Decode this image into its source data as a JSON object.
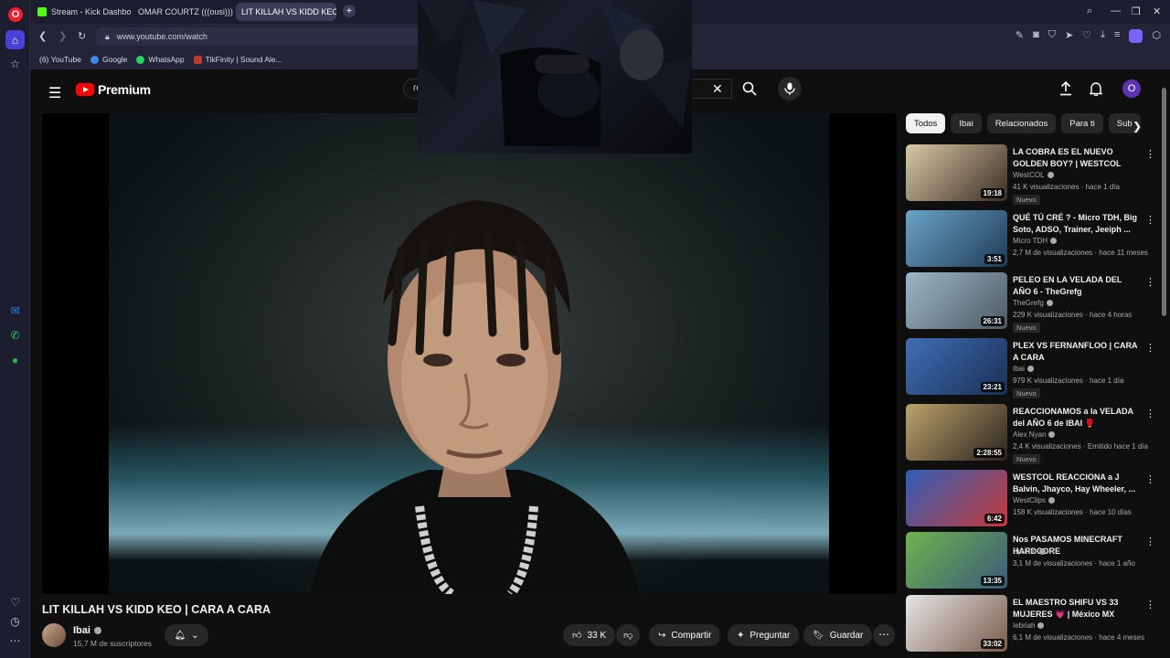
{
  "browser": {
    "tabs": [
      {
        "label": "Stream - Kick Dashboard",
        "favicon": "kick-icon"
      },
      {
        "label": "OMAR COURTZ (((ousi)))",
        "favicon": "youtube-icon"
      },
      {
        "label": "LIT KILLAH VS KIDD KEO |",
        "favicon": "youtube-icon",
        "active": true
      }
    ],
    "url": "www.youtube.com/watch",
    "bookmarks": [
      {
        "label": "(6) YouTube"
      },
      {
        "label": "Google"
      },
      {
        "label": "WhatsApp"
      },
      {
        "label": "TikFinity | Sound Ale..."
      }
    ]
  },
  "youtube": {
    "logo_text": "Premium",
    "search_value": "re",
    "avatar_letter": "O"
  },
  "video": {
    "title": "LIT KILLAH VS KIDD KEO | CARA A CARA",
    "channel": "Ibai",
    "subscribers": "15,7 M de suscriptores",
    "likes": "33 K",
    "share_label": "Compartir",
    "ask_label": "Preguntar",
    "save_label": "Guardar"
  },
  "chips": [
    "Todos",
    "Ibai",
    "Relacionados",
    "Para ti",
    "Sub"
  ],
  "related": [
    {
      "title": "LA COBRA ES EL NUEVO GOLDEN BOY? | WESTCOL",
      "channel": "WestCOL",
      "meta": "41 K visualizaciones · hace 1 día",
      "duration": "19:18",
      "badge": "Nuevo",
      "thumb_colors": [
        "#d8c9a6",
        "#3a2d24"
      ]
    },
    {
      "title": "QUÉ TÚ CRÉ ? - Micro TDH, Big Soto, ADSO, Trainer, Jeeiph ...",
      "channel": "Micro TDH",
      "meta": "2,7 M de visualizaciones · hace 11 meses",
      "duration": "3:51",
      "badge": "",
      "thumb_colors": [
        "#6aa3c8",
        "#1e3b55"
      ]
    },
    {
      "title": "PELEO EN LA VELADA DEL AÑO 6 - TheGrefg",
      "channel": "TheGrefg",
      "meta": "229 K visualizaciones · hace 4 horas",
      "duration": "26:31",
      "badge": "Nuevo",
      "thumb_colors": [
        "#9db6c5",
        "#4d5a63"
      ]
    },
    {
      "title": "PLEX VS FERNANFLOO | CARA A CARA",
      "channel": "Ibai",
      "meta": "979 K visualizaciones · hace 1 día",
      "duration": "23:21",
      "badge": "Nuevo",
      "thumb_colors": [
        "#3f6fb5",
        "#1a2f55"
      ]
    },
    {
      "title": "REACCIONAMOS a la VELADA del AÑO 6 de IBAI 🥊",
      "channel": "Alex Nyan",
      "meta": "2,4 K visualizaciones · Emitido hace 1 día",
      "duration": "2:28:55",
      "badge": "Nuevo",
      "thumb_colors": [
        "#bca36a",
        "#2a2420"
      ]
    },
    {
      "title": "WESTCOL REACCIONA a J Balvin, Jhayco, Hay Wheeler, ...",
      "channel": "WestClips",
      "meta": "158 K visualizaciones · hace 10 días",
      "duration": "6:42",
      "badge": "",
      "thumb_colors": [
        "#2f5fb8",
        "#c43a3a"
      ]
    },
    {
      "title": "Nos PASAMOS MINECRAFT HARDCORE",
      "channel": "Spreen",
      "meta": "3,1 M de visualizaciones · hace 1 año",
      "duration": "13:35",
      "badge": "",
      "thumb_colors": [
        "#6fb34f",
        "#3b5a7a"
      ]
    },
    {
      "title": "EL MAESTRO SHIFU VS 33 MUJERES 💗 | México MX",
      "channel": "Iebriah",
      "meta": "6,1 M de visualizaciones · hace 4 meses",
      "duration": "33:02",
      "badge": "",
      "thumb_colors": [
        "#e6e6e6",
        "#7a5a4a"
      ]
    }
  ],
  "colors": {
    "accent": "#ff0000",
    "opera": "#ff1b2d",
    "browser_bg": "#1c1d2e"
  }
}
